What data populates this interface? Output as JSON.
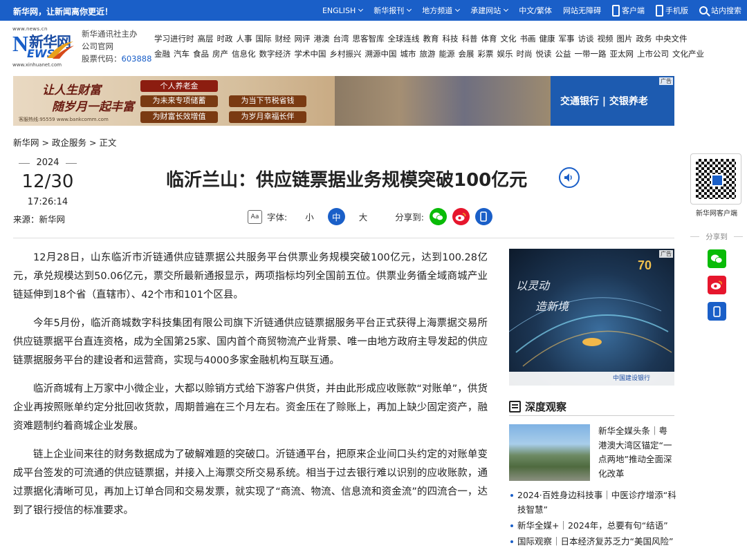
{
  "topbar": {
    "slogan": "新华网，让新闻离你更近！",
    "nav": [
      "ENGLISH",
      "新华报刊",
      "地方频道",
      "承建网站",
      "中文/繁体",
      "网站无障碍",
      "客户端",
      "手机版",
      "站内搜索"
    ]
  },
  "logo": {
    "url_top": "www.news.cn",
    "cn": "新华网",
    "en_n": "N",
    "en_rest": "EWS",
    "url_bottom": "www.xinhuanet.com"
  },
  "org": {
    "line1": "新华通讯社主办",
    "line2": "公司官网",
    "code_label": "股票代码：",
    "code": "603888"
  },
  "main_nav": {
    "row1": [
      "学习进行时",
      "高层",
      "时政",
      "人事",
      "国际",
      "财经",
      "网评",
      "港澳",
      "台湾",
      "思客智库",
      "全球连线",
      "教育",
      "科技",
      "科普",
      "体育",
      "文化",
      "书画",
      "健康",
      "军事",
      "访谈",
      "视频",
      "图片",
      "政务",
      "中央文件"
    ],
    "row2": [
      "金融",
      "汽车",
      "食品",
      "房产",
      "信息化",
      "数字经济",
      "学术中国",
      "乡村振兴",
      "溯源中国",
      "城市",
      "旅游",
      "能源",
      "会展",
      "彩票",
      "娱乐",
      "时尚",
      "悦读",
      "公益",
      "一带一路",
      "亚太网",
      "上市公司",
      "文化产业"
    ]
  },
  "banner": {
    "slogan1": "让人生财富",
    "slogan2": "随岁月一起丰富",
    "hotline": "客服热线:95559 www.bankcomm.com",
    "head": "个人养老金",
    "pills": [
      "为未来专项储蓄",
      "为当下节税省钱",
      "为财富长效增值",
      "为岁月幸福长伴"
    ],
    "brand": "交通银行 | 交银养老",
    "ad_label": "广告"
  },
  "breadcrumb": {
    "home": "新华网",
    "sep": ">",
    "section": "政企服务",
    "current": "正文"
  },
  "date": {
    "year": "2024",
    "md": "12/30",
    "time": "17:26:14",
    "source": "来源：新华网"
  },
  "article": {
    "title": "临沂兰山：供应链票据业务规模突破100亿元",
    "paragraphs": [
      "12月28日，山东临沂市沂链通供应链票据公共服务平台供票业务规模突破100亿元，达到100.28亿元，承兑规模达到50.06亿元，票交所最新通报显示，两项指标均列全国前五位。供票业务循全域商城产业链延伸到18个省（直辖市）、42个市和101个区县。",
      "今年5月份，临沂商城数字科技集团有限公司旗下沂链通供应链票据服务平台正式获得上海票据交易所供应链票据平台直连资格，成为全国第25家、国内首个商贸物流产业背景、唯一由地方政府主导发起的供应链票据服务平台的建设者和运营商，实现与4000多家金融机构互联互通。",
      "临沂商城有上万家中小微企业，大都以赊销方式给下游客户供货，并由此形成应收账款“对账单”，供货企业再按照账单约定分批回收货款，周期普遍在三个月左右。资金压在了赊账上，再加上缺少固定资产，融资难题制约着商城企业发展。",
      "链上企业间来往的财务数据成为了破解难题的突破口。沂链通平台，把原来企业间口头约定的对账单变成平台签发的可流通的供应链票据，并接入上海票交所交易系统。相当于过去银行难以识别的应收账款，通过票据化清晰可见，再加上订单合同和交易发票，就实现了“商流、物流、信息流和资金流”的四流合一，达到了银行授信的标准要求。"
    ]
  },
  "tools": {
    "font_label": "字体:",
    "small": "小",
    "medium": "中",
    "large": "大",
    "share_label": "分享到:",
    "aa": "Aa"
  },
  "side_ad": {
    "cap1": "以灵动",
    "cap2": "造新境",
    "bank": "中国建设银行",
    "ad_label": "广告"
  },
  "side": {
    "section_title": "深度观察",
    "featured_caption": "新华全媒头条｜粤港澳大湾区锚定“一点两地”推动全面深化改革",
    "list": [
      "2024·百姓身边科技事｜中医诊疗增添“科技智慧”",
      "新华全媒+｜2024年，总要有句“结语”",
      "国际观察｜日本经济复苏乏力“美国风险”"
    ]
  },
  "float_panel": {
    "qr_label": "新华网客户端",
    "share_label": "分享到"
  },
  "colors": {
    "brand_blue": "#1a5fc8",
    "wechat": "#09bb07",
    "weibo": "#e6162d"
  }
}
